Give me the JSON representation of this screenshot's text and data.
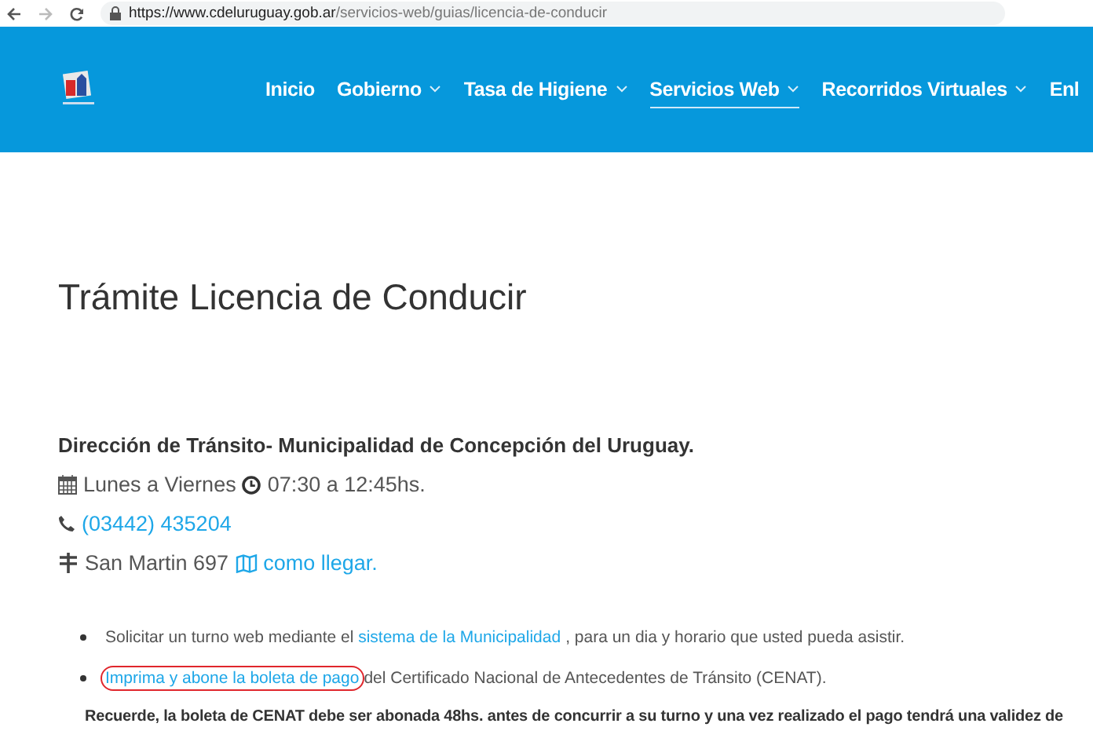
{
  "browser": {
    "url_host": "https://www.cdeluruguay.gob.ar",
    "url_path": "/servicios-web/guias/licencia-de-conducir"
  },
  "nav": [
    {
      "label": "Inicio",
      "dropdown": false,
      "selected": false
    },
    {
      "label": "Gobierno",
      "dropdown": true,
      "selected": false
    },
    {
      "label": "Tasa de Higiene",
      "dropdown": true,
      "selected": false
    },
    {
      "label": "Servicios Web",
      "dropdown": true,
      "selected": true
    },
    {
      "label": "Recorridos Virtuales",
      "dropdown": true,
      "selected": false
    },
    {
      "label": "Enl",
      "dropdown": false,
      "selected": false
    }
  ],
  "page_title": "Trámite Licencia de Conducir",
  "office": "Dirección de Tránsito- Municipalidad de Concepción del Uruguay.",
  "days": "Lunes a Viernes",
  "hours": "07:30 a 12:45hs.",
  "phone": "(03442) 435204",
  "address": "San Martin 697",
  "directions_link": "como llegar.",
  "bullets": [
    {
      "before": "Solicitar un turno web mediante el ",
      "link": "sistema de la Municipalidad",
      "after": ", para un dia y horario que usted pueda asistir.",
      "circled": false
    },
    {
      "link": "Imprima y abone la boleta de pago",
      "after": "del Certificado Nacional de Antecedentes de Tránsito (CENAT).",
      "circled": true
    }
  ],
  "note": "Recuerde, la boleta de CENAT debe ser abonada 48hs. antes de concurrir a su turno y una vez realizado el pago tendrá una validez de"
}
